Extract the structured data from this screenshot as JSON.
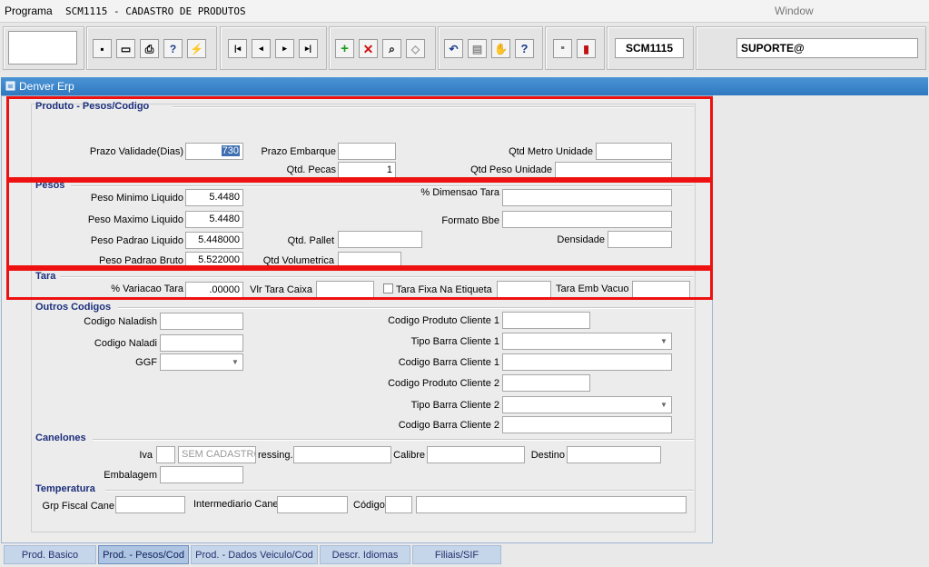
{
  "menubar": {
    "programa": "Programa",
    "title": "SCM1115 - CADASTRO DE PRODUTOS",
    "window": "Window"
  },
  "toolbar": {
    "icons": [
      "save-icon",
      "print-preview-icon",
      "printer-icon",
      "query-icon",
      "execute-icon",
      "first-record-icon",
      "previous-record-icon",
      "next-record-icon",
      "last-record-icon",
      "insert-icon",
      "delete-icon",
      "search-icon",
      "clear-icon",
      "undo-icon",
      "clipboard-icon",
      "tools-icon",
      "help-icon",
      "menu-icon",
      "exit-icon"
    ],
    "form_code": "SCM1115",
    "user": "SUPORTE@"
  },
  "panel_title": "Denver Erp",
  "sections": {
    "produto": "Produto - Pesos/Codigo",
    "pesos": "Pesos",
    "tara": "Tara",
    "outros": "Outros Codigos",
    "canelones": "Canelones",
    "temperatura": "Temperatura"
  },
  "labels": {
    "prazo_validade": "Prazo Validade(Dias)",
    "prazo_embarque": "Prazo Embarque",
    "qtd_metro_unidade": "Qtd Metro Unidade",
    "qtd_pecas": "Qtd. Pecas",
    "qtd_peso_unidade": "Qtd Peso Unidade",
    "peso_minimo": "Peso Minimo Liquido",
    "dimensao_tara": "% Dimensao Tara",
    "peso_maximo": "Peso Maximo Liquido",
    "formato_bbe": "Formato Bbe",
    "peso_padrao_liquido": "Peso Padrao Liquido",
    "qtd_pallet": "Qtd. Pallet",
    "densidade": "Densidade",
    "peso_padrao_bruto": "Peso Padrao Bruto",
    "qtd_volumetrica": "Qtd Volumetrica",
    "variacao_tara": "% Variacao Tara",
    "vlr_tara_caixa": "Vlr Tara Caixa",
    "tara_fixa": "Tara Fixa Na Etiqueta",
    "tara_emb_vacuo": "Tara Emb Vacuo",
    "codigo_naladish": "Codigo Naladish",
    "codigo_produto_cliente1": "Codigo Produto Cliente 1",
    "codigo_naladi": "Codigo Naladi",
    "tipo_barra_cliente1": "Tipo Barra Cliente 1",
    "ggf": "GGF",
    "codigo_barra_cliente1": "Codigo Barra Cliente 1",
    "codigo_produto_cliente2": "Codigo Produto Cliente 2",
    "tipo_barra_cliente2": "Tipo Barra Cliente 2",
    "codigo_barra_cliente2": "Codigo Barra Cliente 2",
    "iva": "Iva",
    "ressing": "ressing.",
    "calibre": "Calibre",
    "destino": "Destino",
    "embalagem": "Embalagem",
    "grp_fiscal_cane": "Grp Fiscal Cane",
    "intermediario_cane": "Intermediario Cane",
    "codigo": "Código"
  },
  "values": {
    "prazo_validade": "730",
    "qtd_pecas": "1",
    "peso_minimo": "5.4480",
    "peso_maximo": "5.4480",
    "peso_padrao_liquido": "5.448000",
    "peso_padrao_bruto": "5.522000",
    "variacao_tara": ".00000",
    "iva_desc": "SEM CADASTRO",
    "tara_fixa_checked": false
  },
  "tabs": [
    "Prod. Basico",
    "Prod. - Pesos/Cod",
    "Prod. - Dados Veiculo/Cod",
    "Descr. Idiomas",
    "Filiais/SIF"
  ],
  "active_tab": "Prod. - Pesos/Cod",
  "colors": {
    "section": "#1c2f7c",
    "titlebar": "#3a84cc",
    "highlight": "#ee1111"
  }
}
